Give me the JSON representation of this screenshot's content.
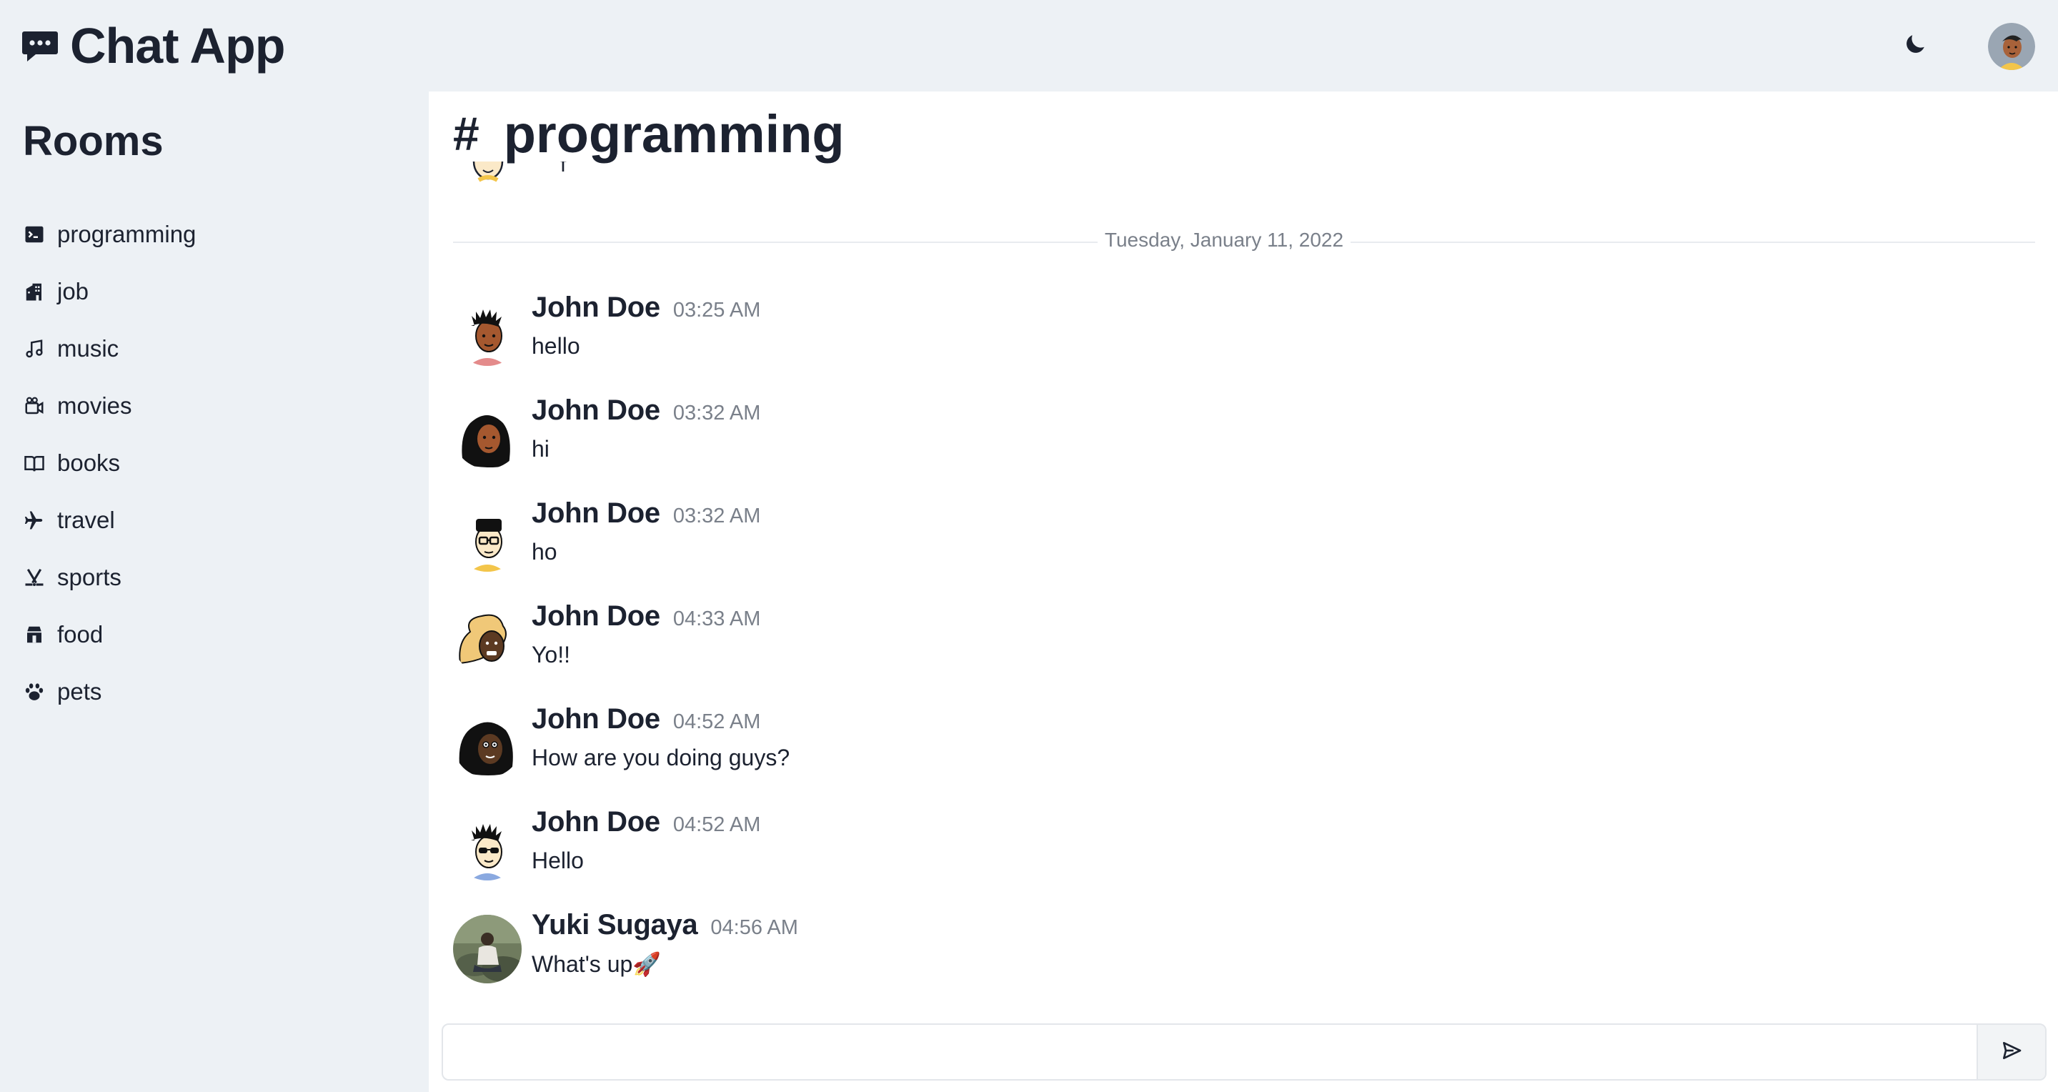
{
  "app": {
    "title": "Chat App",
    "icons": {
      "brand": "chat-bubble-icon",
      "theme": "moon-icon",
      "profile": "avatar"
    }
  },
  "sidebar": {
    "heading": "Rooms",
    "rooms": [
      {
        "label": "programming",
        "icon": "terminal-icon"
      },
      {
        "label": "job",
        "icon": "office-building-icon"
      },
      {
        "label": "music",
        "icon": "music-note-icon"
      },
      {
        "label": "movies",
        "icon": "video-camera-icon"
      },
      {
        "label": "books",
        "icon": "open-book-icon"
      },
      {
        "label": "travel",
        "icon": "airplane-icon"
      },
      {
        "label": "sports",
        "icon": "hockey-icon"
      },
      {
        "label": "food",
        "icon": "store-icon"
      },
      {
        "label": "pets",
        "icon": "paw-icon"
      }
    ]
  },
  "channel": {
    "hash": "#",
    "name": "programming",
    "partial_message_text": "f",
    "date_divider": "Tuesday, January 11, 2022",
    "messages": [
      {
        "author": "John Doe",
        "time": "03:25 AM",
        "text": "hello"
      },
      {
        "author": "John Doe",
        "time": "03:32 AM",
        "text": "hi"
      },
      {
        "author": "John Doe",
        "time": "03:32 AM",
        "text": "ho"
      },
      {
        "author": "John Doe",
        "time": "04:33 AM",
        "text": "Yo!!"
      },
      {
        "author": "John Doe",
        "time": "04:52 AM",
        "text": "How are you doing guys?"
      },
      {
        "author": "John Doe",
        "time": "04:52 AM",
        "text": "Hello"
      },
      {
        "author": "Yuki Sugaya",
        "time": "04:56 AM",
        "text": "What's up🚀"
      }
    ]
  },
  "composer": {
    "value": "",
    "placeholder": "",
    "send_icon": "send-icon"
  },
  "colors": {
    "background": "#edf1f5",
    "panel": "#ffffff",
    "text": "#1c2230",
    "muted": "#7a808a",
    "divider": "#e8ebef"
  }
}
